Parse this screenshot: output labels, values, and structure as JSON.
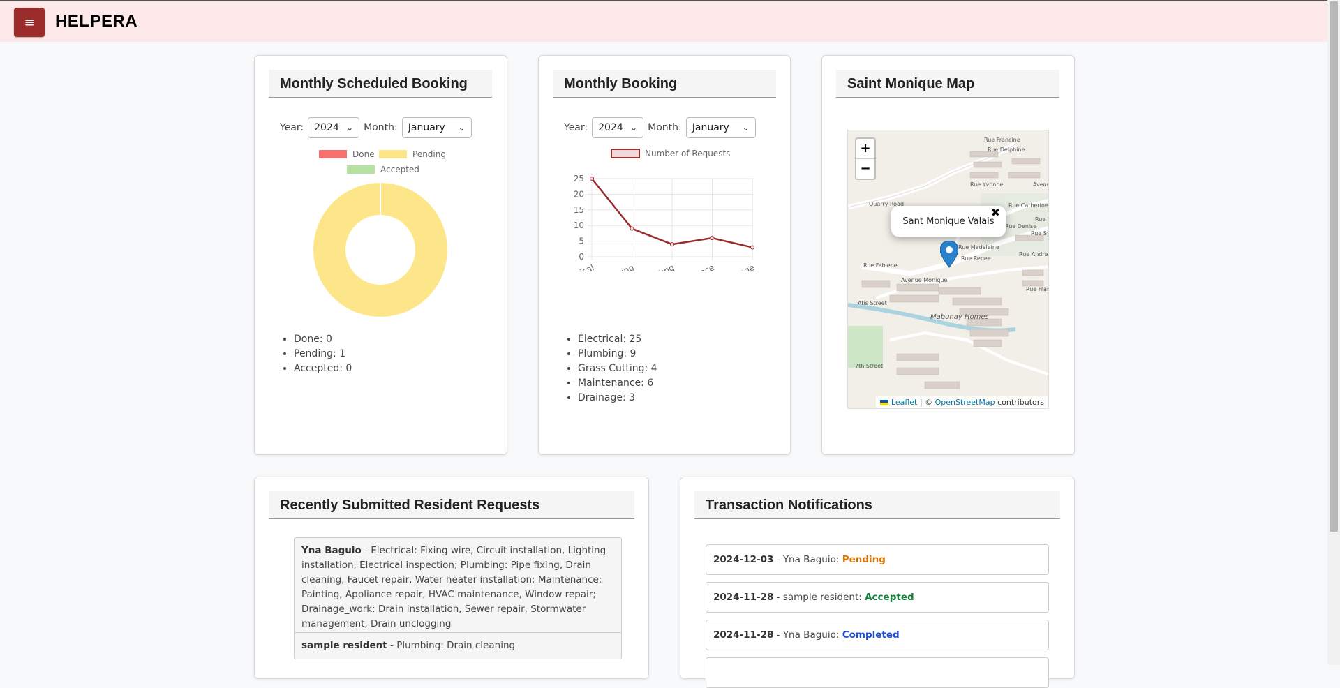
{
  "app": {
    "brand": "HELPERA",
    "menu_icon": "≡"
  },
  "scheduled_card": {
    "title": "Monthly Scheduled Booking",
    "year_label": "Year:",
    "year_value": "2024",
    "month_label": "Month:",
    "month_value": "January",
    "legend": [
      {
        "label": "Done",
        "color": "#f87171"
      },
      {
        "label": "Pending",
        "color": "#fde68a"
      },
      {
        "label": "Accepted",
        "color": "#b7e1a1"
      }
    ],
    "stats": [
      "Done: 0",
      "Pending: 1",
      "Accepted: 0"
    ]
  },
  "booking_card": {
    "title": "Monthly Booking",
    "year_label": "Year:",
    "year_value": "2024",
    "month_label": "Month:",
    "month_value": "January",
    "stats": [
      "Electrical: 25",
      "Plumbing: 9",
      "Grass Cutting: 4",
      "Maintenance: 6",
      "Drainage: 3"
    ]
  },
  "map_card": {
    "title": "Saint Monique Map",
    "zoom_in": "+",
    "zoom_out": "−",
    "popup_text": "Sant Monique Valais",
    "popup_close": "✖",
    "attribution_leaflet": "Leaflet",
    "attribution_sep": "|",
    "attribution_copy": "©",
    "attribution_osm": "OpenStreetMap",
    "attribution_tail": "contributors",
    "labels": [
      "Quarry Road",
      "Rue Francine",
      "Rue Delphine",
      "Rue Yvonne",
      "Rue Catherine",
      "Rue Denise",
      "Rue Fabiene",
      "Avenue Monique",
      "Rue Renee",
      "Rue Andree",
      "Rue Francette",
      "Atis Street",
      "Mabuhay Homes",
      "Avenue Ma",
      "Rue Sylvi",
      "Rue Di",
      "Rue Madeleine",
      "7th Street"
    ]
  },
  "requests_card": {
    "title": "Recently Submitted Resident Requests",
    "items": [
      {
        "name": "Yna Baguio",
        "text": " - Electrical: Fixing wire, Circuit installation, Lighting installation, Electrical inspection; Plumbing: Pipe fixing, Drain cleaning, Faucet repair, Water heater installation; Maintenance: Painting, Appliance repair, HVAC maintenance, Window repair; Drainage_work: Drain installation, Sewer repair, Stormwater management, Drain unclogging"
      },
      {
        "name": "sample resident",
        "text": " - Plumbing: Drain cleaning"
      }
    ]
  },
  "notifications_card": {
    "title": "Transaction Notifications",
    "items": [
      {
        "date": "2024-12-03",
        "who": " - Yna Baguio: ",
        "status": "Pending",
        "color": "#d97706"
      },
      {
        "date": "2024-11-28",
        "who": " - sample resident: ",
        "status": "Accepted",
        "color": "#15803d"
      },
      {
        "date": "2024-11-28",
        "who": " - Yna Baguio: ",
        "status": "Completed",
        "color": "#1d4ed8"
      }
    ]
  },
  "chart_data": [
    {
      "type": "pie",
      "title": "",
      "categories": [
        "Done",
        "Pending",
        "Accepted"
      ],
      "values": [
        0,
        1,
        0
      ],
      "donut": true,
      "colors": [
        "#f87171",
        "#fde68a",
        "#b7e1a1"
      ],
      "legend_position": "top"
    },
    {
      "type": "line",
      "title": "",
      "categories": [
        "Electrical",
        "Plumbing",
        "Grass Cutting",
        "Maintenance",
        "Drainage"
      ],
      "series": [
        {
          "name": "Number of Requests",
          "values": [
            25,
            9,
            4,
            6,
            3
          ],
          "color": "#9b2c2c"
        }
      ],
      "ylim": [
        0,
        25
      ],
      "yticks": [
        0,
        5,
        10,
        15,
        20,
        25
      ],
      "grid": true,
      "legend_position": "top"
    }
  ]
}
